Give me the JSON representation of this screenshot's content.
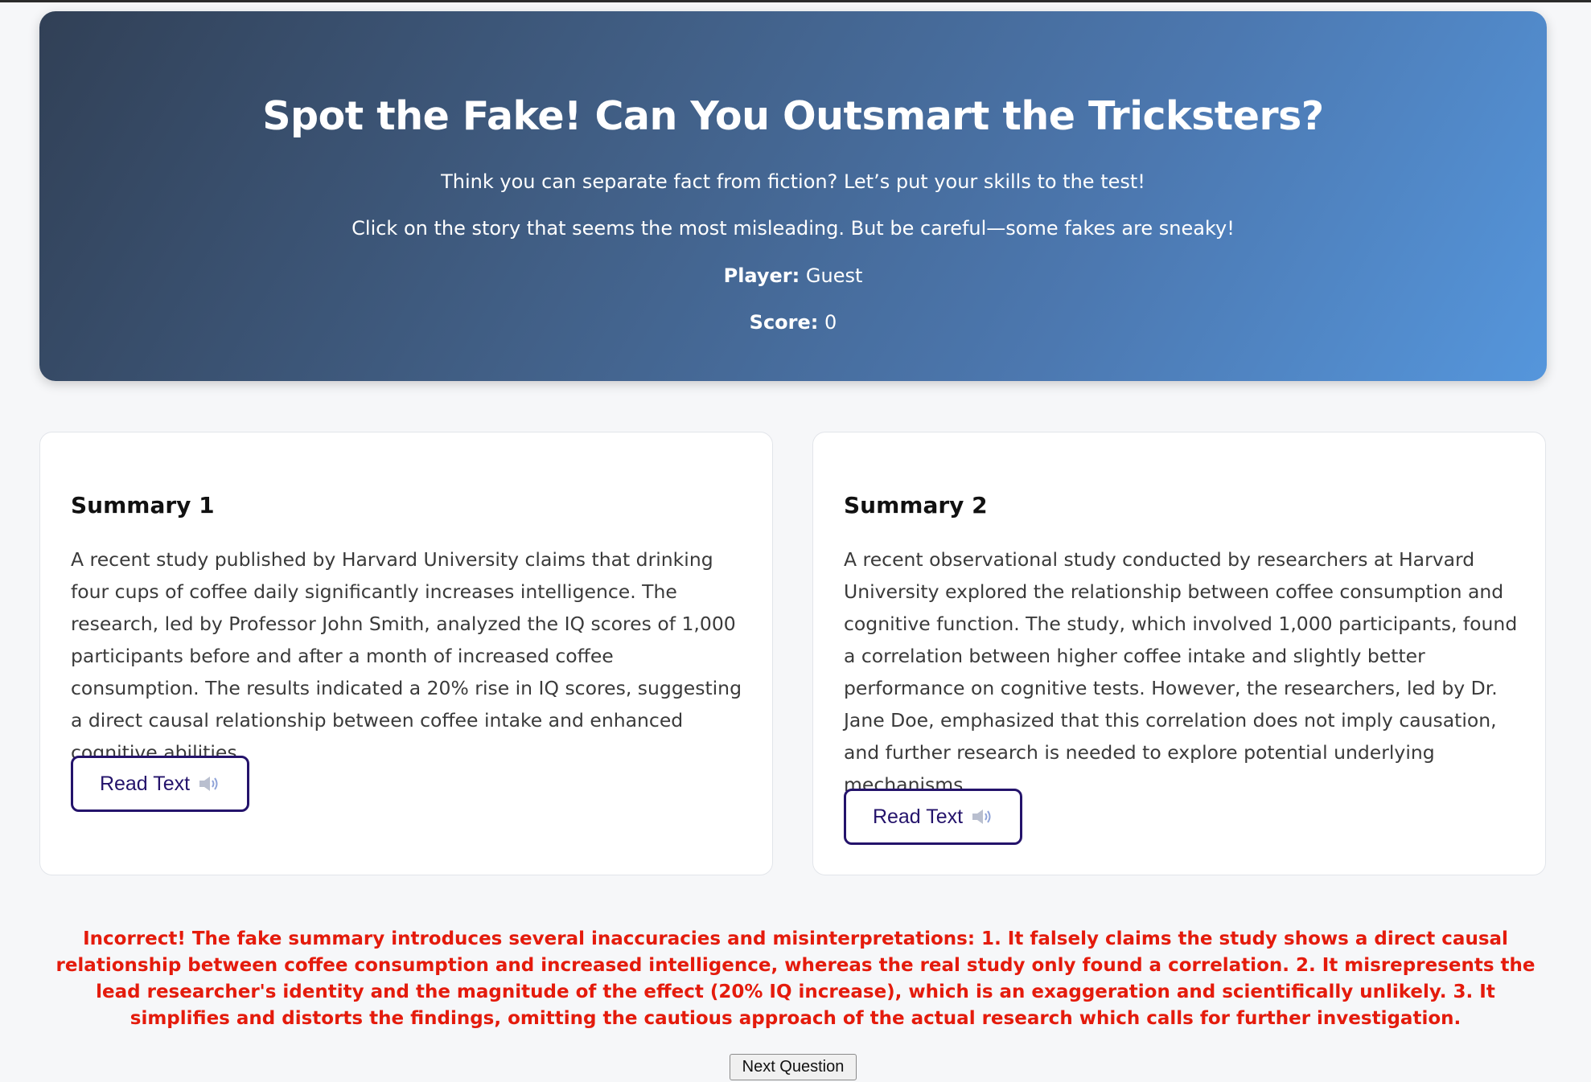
{
  "header": {
    "title": "Spot the Fake! Can You Outsmart the Tricksters?",
    "intro": "Think you can separate fact from fiction? Let’s put your skills to the test!",
    "instructions": "Click on the story that seems the most misleading. But be careful—some fakes are sneaky!",
    "player_label": "Player:",
    "player_name": "Guest",
    "score_label": "Score:",
    "score_value": "0"
  },
  "summaries": [
    {
      "title": "Summary 1",
      "text": "A recent study published by Harvard University claims that drinking four cups of coffee daily significantly increases intelligence. The research, led by Professor John Smith, analyzed the IQ scores of 1,000 participants before and after a month of increased coffee consumption. The results indicated a 20% rise in IQ scores, suggesting a direct causal relationship between coffee intake and enhanced cognitive abilities.",
      "read_label": "Read Text",
      "icon": "speaker-icon"
    },
    {
      "title": "Summary 2",
      "text": "A recent observational study conducted by researchers at Harvard University explored the relationship between coffee consumption and cognitive function. The study, which involved 1,000 participants, found a correlation between higher coffee intake and slightly better performance on cognitive tests. However, the researchers, led by Dr. Jane Doe, emphasized that this correlation does not imply causation, and further research is needed to explore potential underlying mechanisms.",
      "read_label": "Read Text",
      "icon": "speaker-icon"
    }
  ],
  "feedback": {
    "text": "Incorrect! The fake summary introduces several inaccuracies and misinterpretations: 1. It falsely claims the study shows a direct causal relationship between coffee consumption and increased intelligence, whereas the real study only found a correlation. 2. It misrepresents the lead researcher's identity and the magnitude of the effect (20% IQ increase), which is an exaggeration and scientifically unlikely. 3. It simplifies and distorts the findings, omitting the cautious approach of the actual research which calls for further investigation.",
    "color": "#e41b0c"
  },
  "next_button": {
    "label": "Next Question"
  },
  "colors": {
    "hero_gradient_start": "#314056",
    "hero_gradient_end": "#5596dc",
    "button_border": "#24136b"
  }
}
